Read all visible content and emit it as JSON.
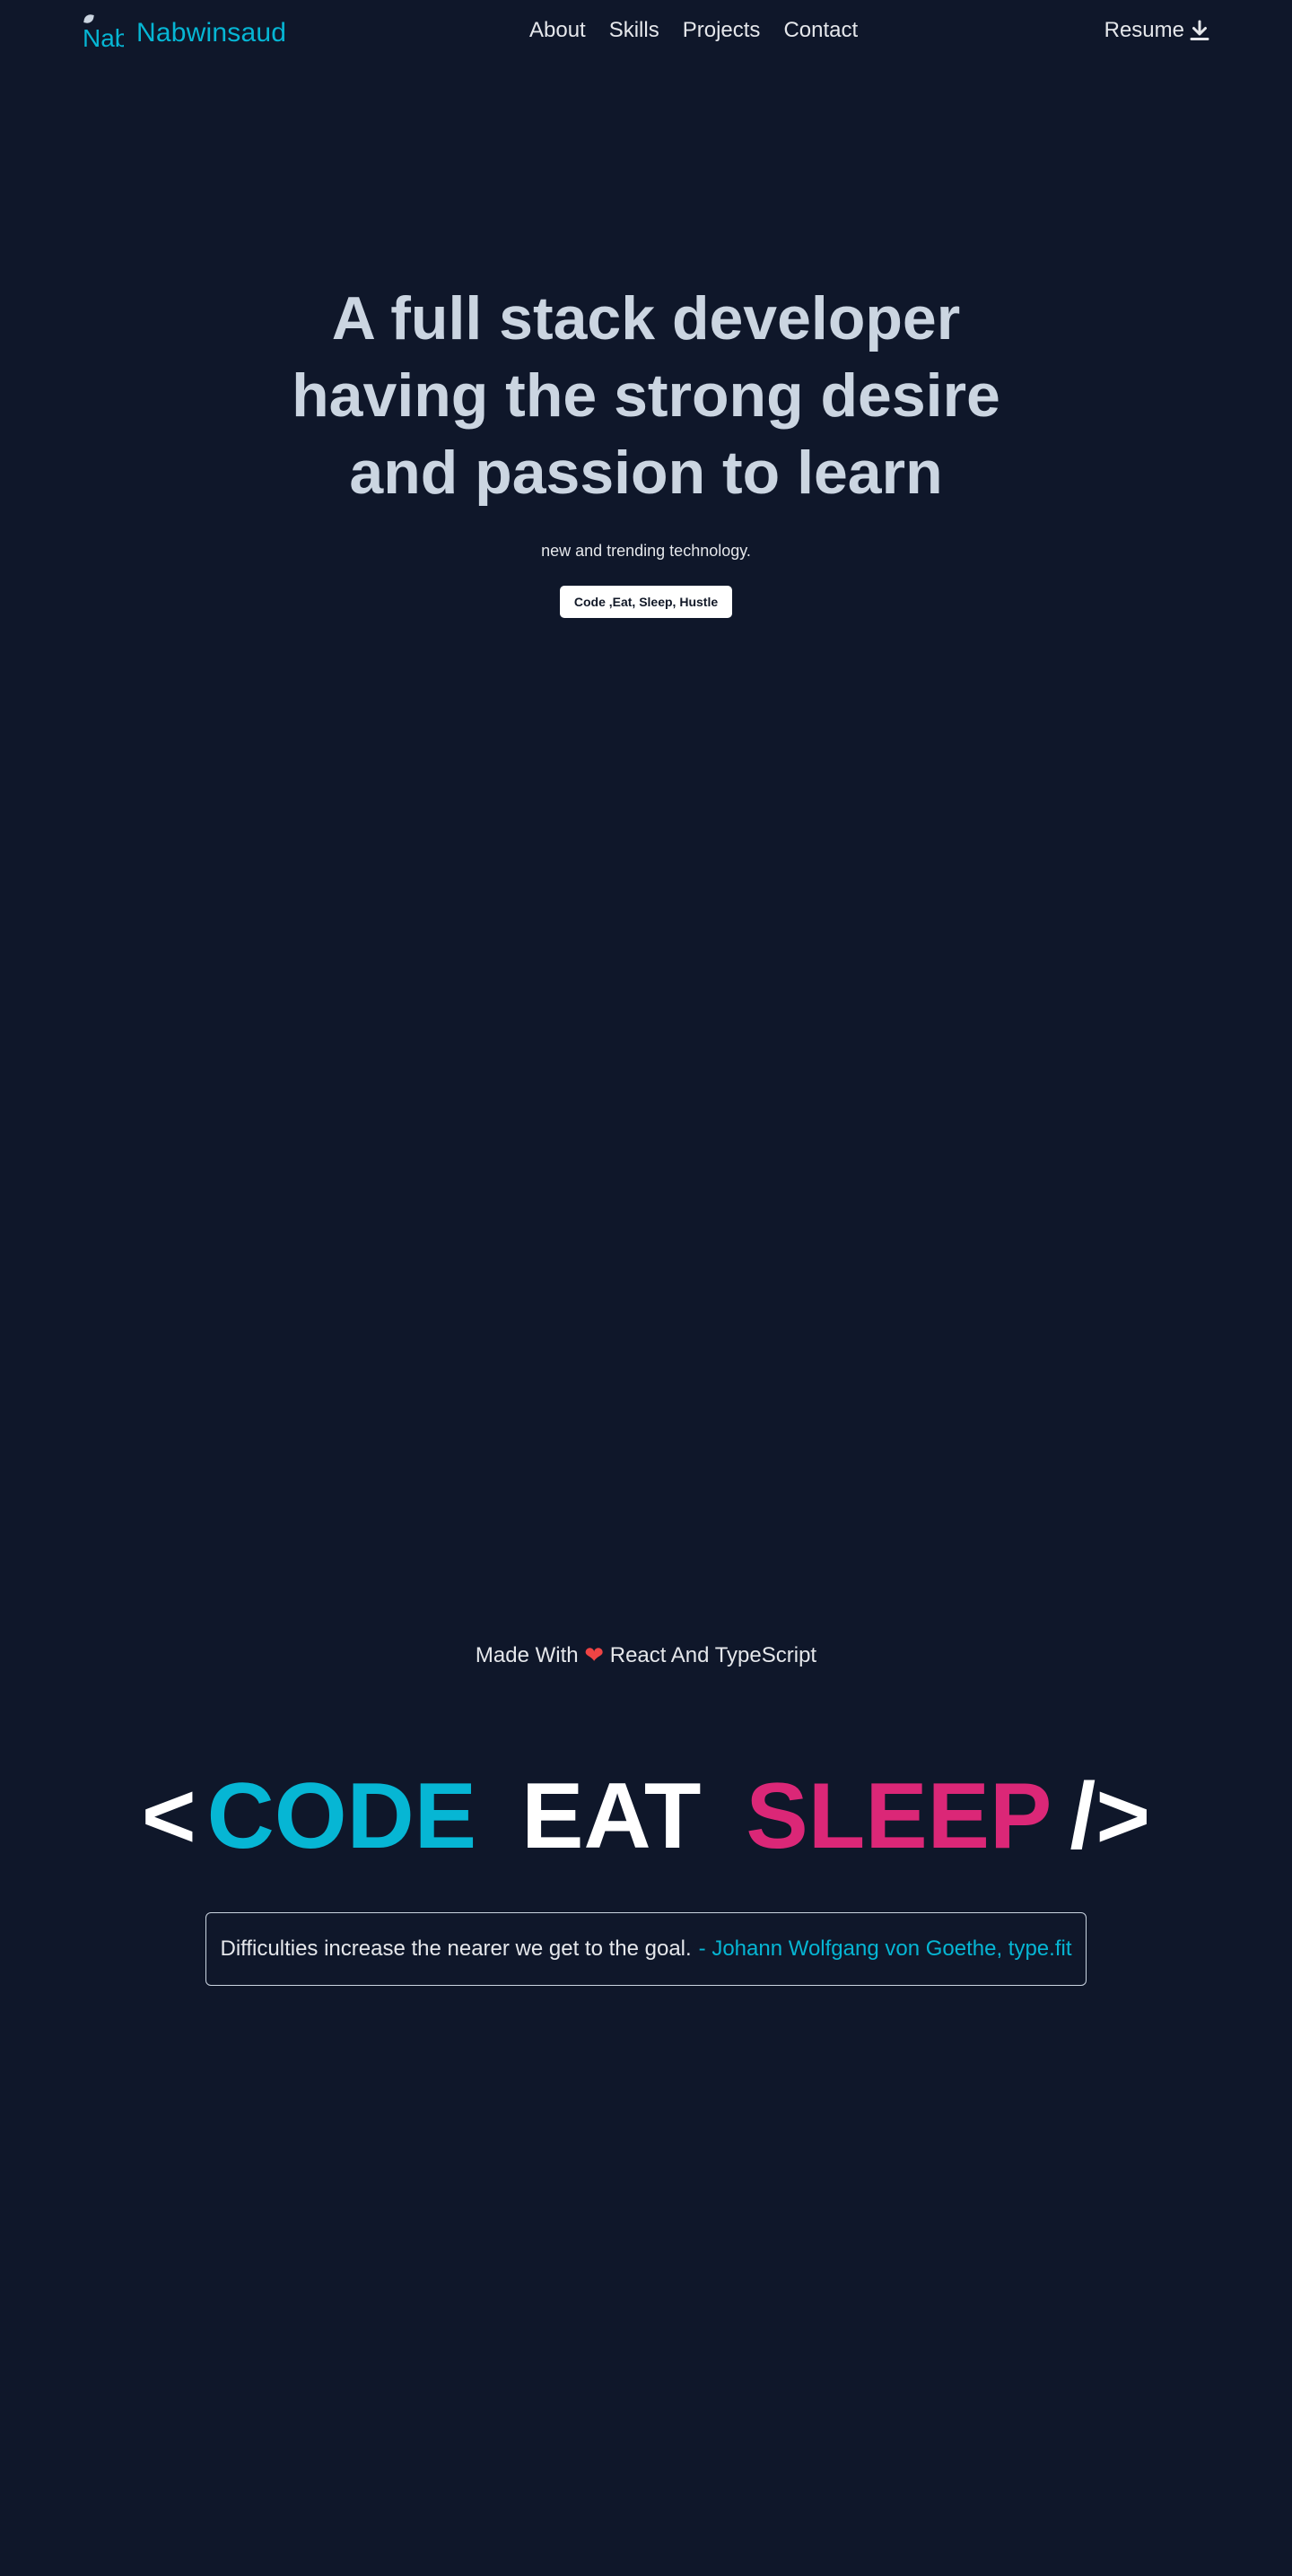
{
  "header": {
    "logo_text": "Nab",
    "brand_name": "Nabwinsaud",
    "nav": [
      "About",
      "Skills",
      "Projects",
      "Contact"
    ],
    "resume_label": "Resume",
    "resume_icon": "download-icon"
  },
  "hero": {
    "title": "A full stack developer having the strong desire and passion to learn",
    "subtitle": "new and trending technology.",
    "button_label": "Code ,Eat, Sleep, Hustle"
  },
  "footer_note": {
    "before": "Made With",
    "heart": "❤",
    "after": "React And TypeScript"
  },
  "slogan": {
    "open": "<",
    "word1": "CODE",
    "word2": "EAT",
    "word3": "SLEEP",
    "close": "/>"
  },
  "quote": {
    "text": "Difficulties increase the nearer we get to the goal.",
    "author": "- Johann Wolfgang von Goethe, type.fit"
  },
  "colors": {
    "background": "#0f172a",
    "accent_cyan": "#06b6d4",
    "accent_pink": "#db2777",
    "text": "#e5e7eb",
    "heading": "#cbd5e1"
  }
}
